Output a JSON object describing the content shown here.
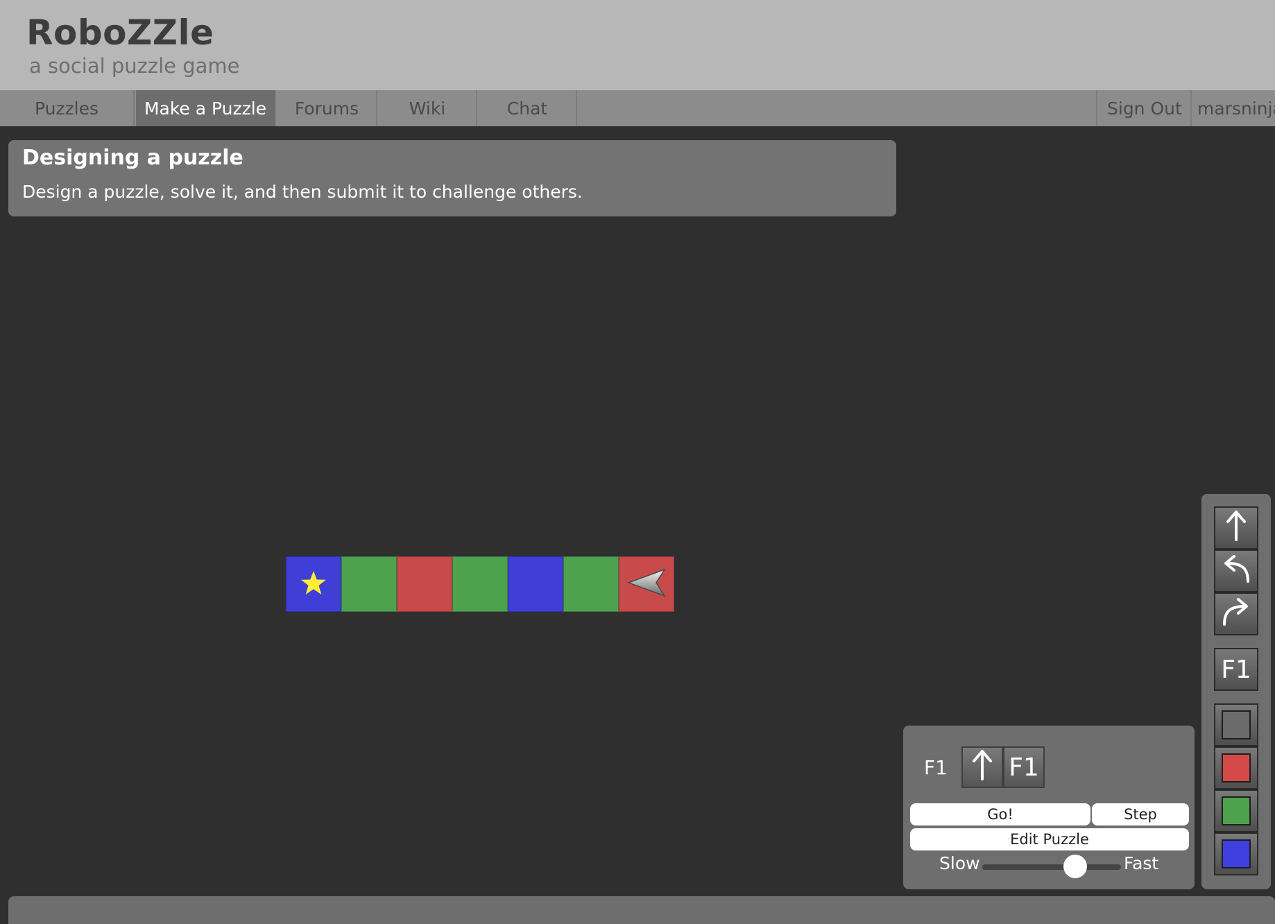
{
  "header": {
    "title": "RoboZZle",
    "subtitle": "a social puzzle game"
  },
  "nav": {
    "items": [
      {
        "label": "Puzzles",
        "active": false
      },
      {
        "label": "Make a Puzzle",
        "active": true
      },
      {
        "label": "Forums",
        "active": false
      },
      {
        "label": "Wiki",
        "active": false
      },
      {
        "label": "Chat",
        "active": false
      }
    ],
    "sign_out": "Sign Out",
    "username": "marsninja"
  },
  "info": {
    "title": "Designing a puzzle",
    "description": "Design a puzzle, solve it, and then submit it to challenge others."
  },
  "board": {
    "tiles": [
      {
        "color": "blue",
        "item": "star-icon"
      },
      {
        "color": "green"
      },
      {
        "color": "red"
      },
      {
        "color": "green"
      },
      {
        "color": "blue"
      },
      {
        "color": "green"
      },
      {
        "color": "red",
        "item": "robot-arrow-icon",
        "direction": "left"
      }
    ]
  },
  "colors": {
    "blue": "#3f3fd8",
    "green": "#4ea24e",
    "red": "#c84a4a",
    "gray": "#6b6b6b",
    "star": "#ffee33"
  },
  "program": {
    "function_label": "F1",
    "slots": [
      {
        "icon": "forward-arrow-icon",
        "label": ""
      },
      {
        "icon": "",
        "label": "F1"
      }
    ],
    "go_label": "Go!",
    "step_label": "Step",
    "edit_label": "Edit Puzzle",
    "slow_label": "Slow",
    "fast_label": "Fast",
    "speed": 0.67
  },
  "palette": {
    "commands": [
      "forward-arrow-icon",
      "turn-left-icon",
      "turn-right-icon"
    ],
    "function_label": "F1",
    "color_swatches": [
      "gray",
      "red",
      "green",
      "blue"
    ]
  }
}
